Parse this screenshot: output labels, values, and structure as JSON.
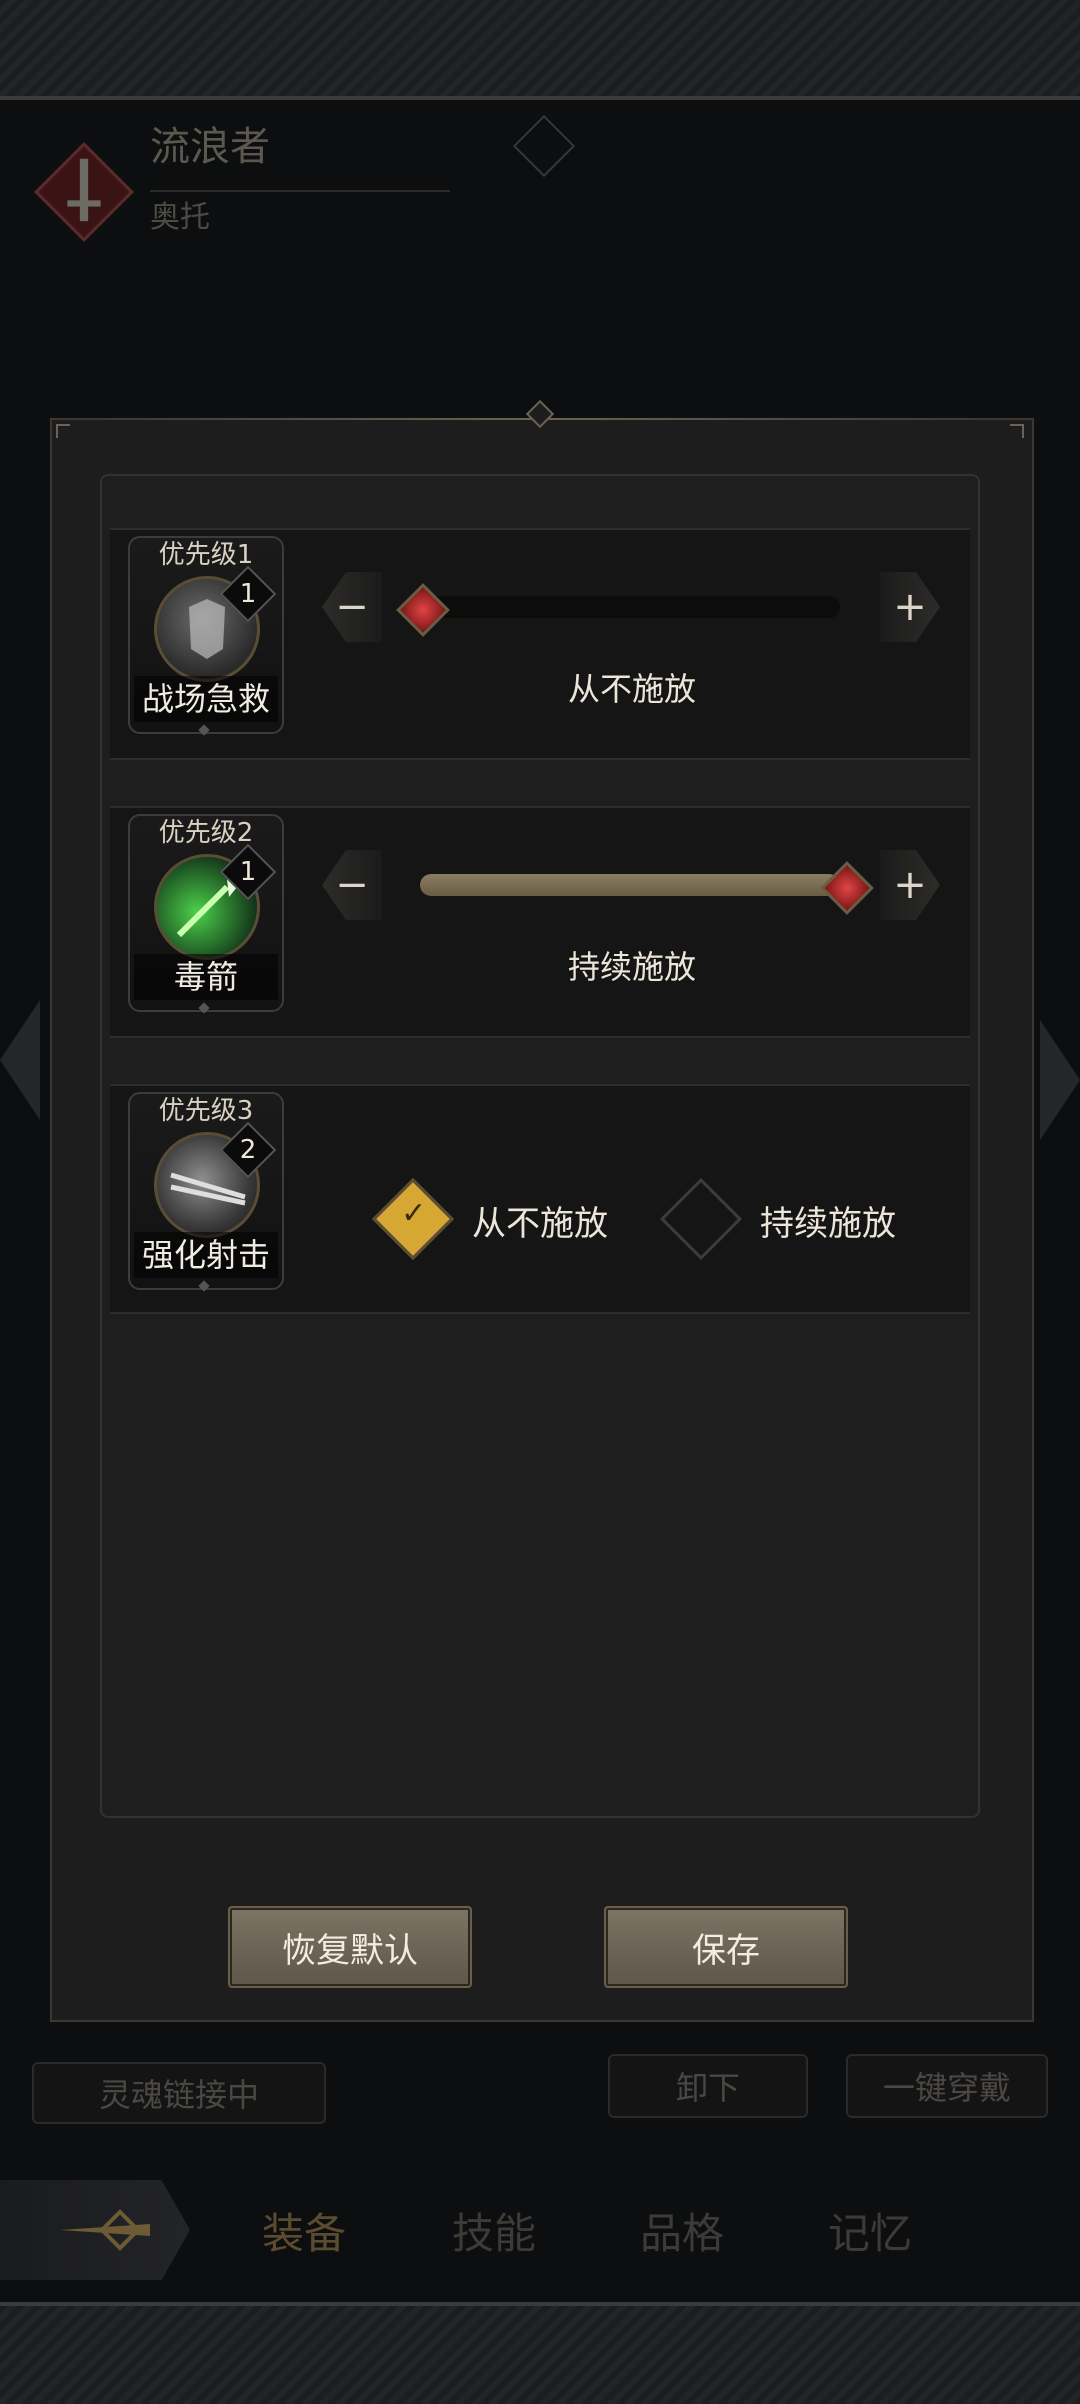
{
  "background": {
    "character_class": "流浪者",
    "character_name": "奥托",
    "soul_link_label": "灵魂链接中",
    "unequip_label": "卸下",
    "equip_all_label": "一键穿戴",
    "tabs": [
      {
        "label": "装备",
        "active": true
      },
      {
        "label": "技能",
        "active": false
      },
      {
        "label": "品格",
        "active": false
      },
      {
        "label": "记忆",
        "active": false
      }
    ]
  },
  "dialog": {
    "skills": [
      {
        "priority": "优先级1",
        "name": "战场急救",
        "level": "1",
        "control": "slider",
        "minus_label": "−",
        "plus_label": "+",
        "mode": "从不施放",
        "slider_value": 0
      },
      {
        "priority": "优先级2",
        "name": "毒箭",
        "level": "1",
        "control": "slider",
        "minus_label": "−",
        "plus_label": "+",
        "mode": "持续施放",
        "slider_value": 1
      },
      {
        "priority": "优先级3",
        "name": "强化射击",
        "level": "2",
        "control": "options",
        "options": [
          {
            "label": "从不施放",
            "checked": true
          },
          {
            "label": "持续施放",
            "checked": false
          }
        ]
      }
    ],
    "buttons": {
      "reset": "恢复默认",
      "save": "保存"
    }
  },
  "colors": {
    "accent_gold": "#d6a733",
    "knob_red": "#c62e2e",
    "panel_bg": "#1d1d1d"
  }
}
